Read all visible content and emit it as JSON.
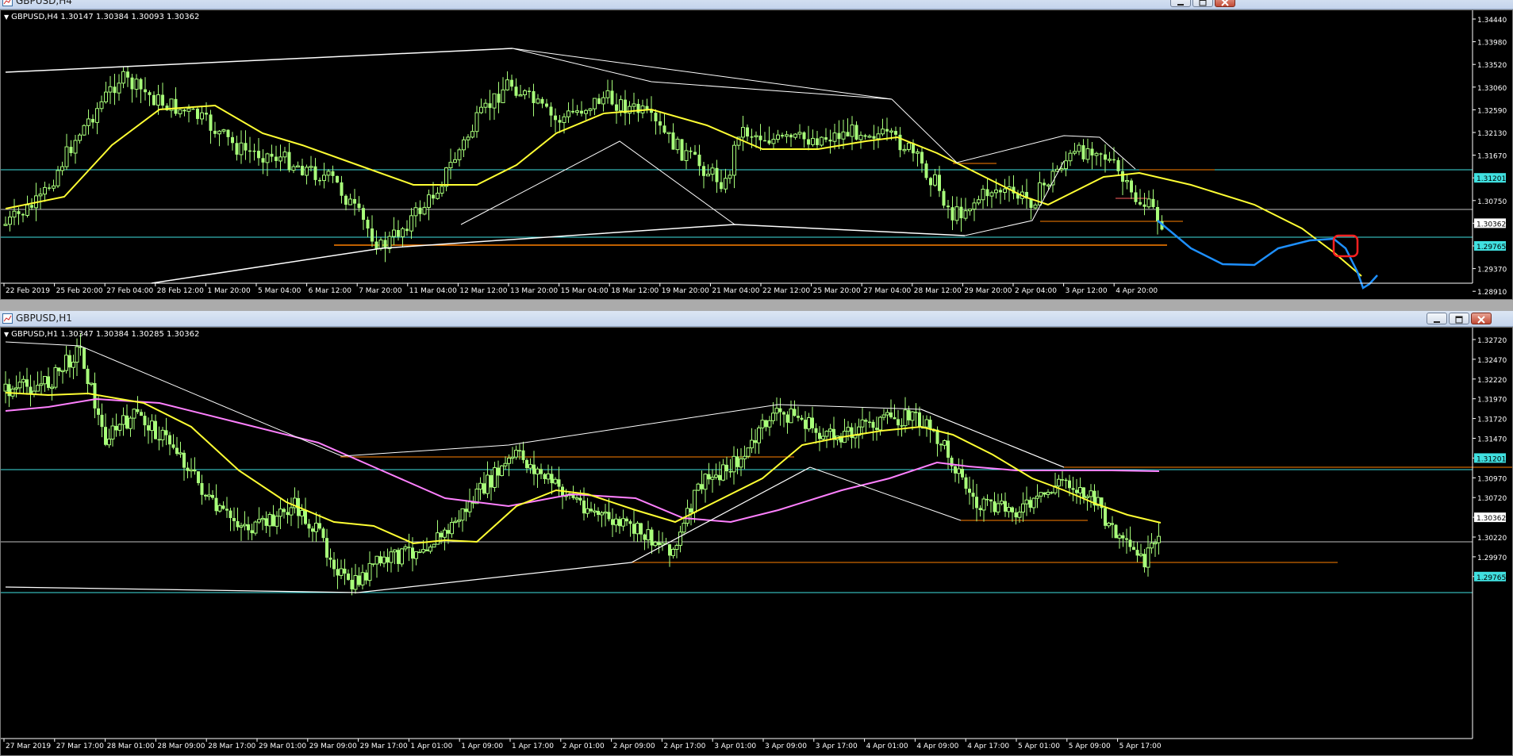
{
  "colors": {
    "bull": "#A8FF7A",
    "ma_fast": "#FFFF33",
    "ma_slow": "#FF80FF",
    "trend": "#FFFFFF",
    "level": "#FF8000",
    "hline": "#40E0E0",
    "price_line": "#C0C0C0",
    "forecast": "#1E90FF",
    "circle": "#FF2020"
  },
  "charts": [
    {
      "title": "GBPUSD,H4",
      "header": "GBPUSD,H4  1.30147 1.30384 1.30093 1.30362",
      "price_axis": [
        "1.34440",
        "1.33980",
        "1.33520",
        "1.33060",
        "1.32590",
        "1.32130",
        "1.31670",
        "1.31201",
        "1.30750",
        "1.30362",
        "1.29765",
        "1.29370",
        "1.28910"
      ],
      "time_axis": [
        "22 Feb 2019",
        "25 Feb 20:00",
        "27 Feb 04:00",
        "28 Feb 12:00",
        "1 Mar 20:00",
        "5 Mar 04:00",
        "6 Mar 12:00",
        "7 Mar 20:00",
        "11 Mar 04:00",
        "12 Mar 12:00",
        "13 Mar 20:00",
        "15 Mar 04:00",
        "18 Mar 12:00",
        "19 Mar 20:00",
        "21 Mar 04:00",
        "22 Mar 12:00",
        "25 Mar 20:00",
        "27 Mar 04:00",
        "28 Mar 12:00",
        "29 Mar 20:00",
        "2 Apr 04:00",
        "3 Apr 12:00",
        "4 Apr 20:00"
      ],
      "highlight_levels": [
        "1.31201",
        "1.30362",
        "1.29765"
      ]
    },
    {
      "title": "GBPUSD,H1",
      "header": "GBPUSD,H1  1.30347 1.30384 1.30285 1.30362",
      "price_axis": [
        "1.32720",
        "1.32470",
        "1.32220",
        "1.31970",
        "1.31720",
        "1.31470",
        "1.31201",
        "1.30970",
        "1.30720",
        "1.30362",
        "1.30220",
        "1.29970",
        "1.29765"
      ],
      "time_axis": [
        "27 Mar 2019",
        "27 Mar 17:00",
        "28 Mar 01:00",
        "28 Mar 09:00",
        "28 Mar 17:00",
        "29 Mar 01:00",
        "29 Mar 09:00",
        "29 Mar 17:00",
        "1 Apr 01:00",
        "1 Apr 09:00",
        "1 Apr 17:00",
        "2 Apr 01:00",
        "2 Apr 09:00",
        "2 Apr 17:00",
        "3 Apr 01:00",
        "3 Apr 09:00",
        "3 Apr 17:00",
        "4 Apr 01:00",
        "4 Apr 09:00",
        "4 Apr 17:00",
        "5 Apr 01:00",
        "5 Apr 09:00",
        "5 Apr 17:00"
      ],
      "highlight_levels": [
        "1.31201",
        "1.30362",
        "1.29765"
      ]
    }
  ],
  "icons": {
    "window": "chart-window-icon",
    "minimize": "minimize-icon",
    "maximize": "maximize-icon",
    "close": "close-icon"
  }
}
